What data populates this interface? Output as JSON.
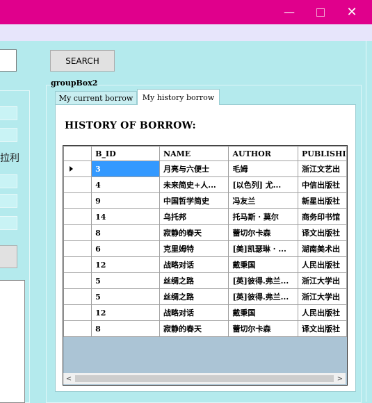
{
  "window": {
    "minimize_glyph": "—",
    "close_glyph": "✕"
  },
  "toolbar": {
    "search_label": "SEARCH"
  },
  "left_panel": {
    "partial_label": "拉利"
  },
  "groupbox": {
    "title": "groupBox2"
  },
  "tabs": [
    {
      "label": "My current borrow",
      "active": false
    },
    {
      "label": "My history borrow",
      "active": true
    }
  ],
  "history": {
    "heading": "HISTORY OF BORROW:",
    "columns": [
      "B_ID",
      "NAME",
      "AUTHOR",
      "PUBLISHI"
    ],
    "rows": [
      {
        "b_id": "3",
        "name": "月亮与六便士",
        "author": "毛姆",
        "publisher": "浙江文艺出",
        "selected": true
      },
      {
        "b_id": "4",
        "name": "未来简史+人...",
        "author": "[以色列] 尤...",
        "publisher": "中信出版社"
      },
      {
        "b_id": "9",
        "name": "中国哲学简史",
        "author": "冯友兰",
        "publisher": "新星出版社"
      },
      {
        "b_id": "14",
        "name": "乌托邦",
        "author": "托马斯 · 莫尔",
        "publisher": "商务印书馆"
      },
      {
        "b_id": "8",
        "name": "寂静的春天",
        "author": "蕾切尔卡森",
        "publisher": "译文出版社"
      },
      {
        "b_id": "6",
        "name": "克里姆特",
        "author": "[美]凯瑟琳 · ...",
        "publisher": "湖南美术出"
      },
      {
        "b_id": "12",
        "name": "战略对话",
        "author": "戴秉国",
        "publisher": "人民出版社"
      },
      {
        "b_id": "5",
        "name": "丝绸之路",
        "author": "[英]彼得.弗兰...",
        "publisher": "浙江大学出"
      },
      {
        "b_id": "5",
        "name": "丝绸之路",
        "author": "[英]彼得.弗兰...",
        "publisher": "浙江大学出"
      },
      {
        "b_id": "12",
        "name": "战略对话",
        "author": "戴秉国",
        "publisher": "人民出版社"
      },
      {
        "b_id": "8",
        "name": "寂静的春天",
        "author": "蕾切尔卡森",
        "publisher": "译文出版社"
      }
    ]
  },
  "scrollbar": {
    "left_glyph": "<",
    "right_glyph": ">"
  }
}
